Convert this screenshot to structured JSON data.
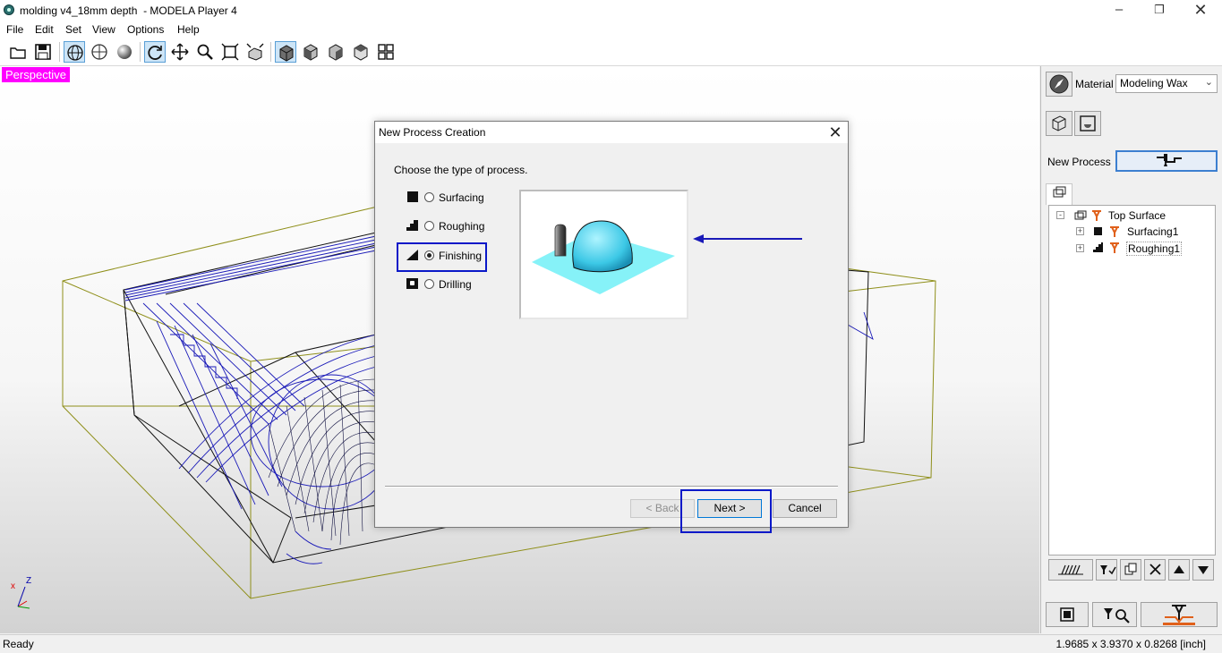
{
  "window": {
    "title": "molding v4_18mm depth  - MODELA Player 4",
    "minimize_icon": "minimize-icon",
    "maximize_icon": "restore-icon",
    "close_icon": "close-icon"
  },
  "menu": [
    "File",
    "Edit",
    "Set",
    "View",
    "Options",
    "Help"
  ],
  "toolbar": {
    "icons": [
      "open-folder-icon",
      "save-icon",
      "wireframe-view-icon",
      "surface-view-icon",
      "shaded-view-icon",
      "rotate-icon",
      "pan-icon",
      "zoom-icon",
      "fit-icon",
      "zoom-box-icon",
      "perspective-view-icon",
      "front-view-icon",
      "side-view-icon",
      "top-view-icon",
      "multi-view-icon"
    ]
  },
  "viewport": {
    "view_label": "Perspective",
    "axis_x": "x",
    "axis_z": "Z"
  },
  "right_panel": {
    "material_label": "Material",
    "material_value": "Modeling Wax",
    "new_process_label": "New Process",
    "tree": {
      "root": "Top Surface",
      "children": [
        "Surfacing1",
        "Roughing1"
      ]
    }
  },
  "dialog": {
    "title": "New Process Creation",
    "prompt": "Choose the type of process.",
    "options": [
      "Surfacing",
      "Roughing",
      "Finishing",
      "Drilling"
    ],
    "selected": "Finishing",
    "back_label": "< Back",
    "next_label": "Next >",
    "cancel_label": "Cancel",
    "accent_color": "#0a18c8"
  },
  "status": {
    "left": "Ready",
    "right": "1.9685 x 3.9370 x 0.8268 [inch]"
  }
}
